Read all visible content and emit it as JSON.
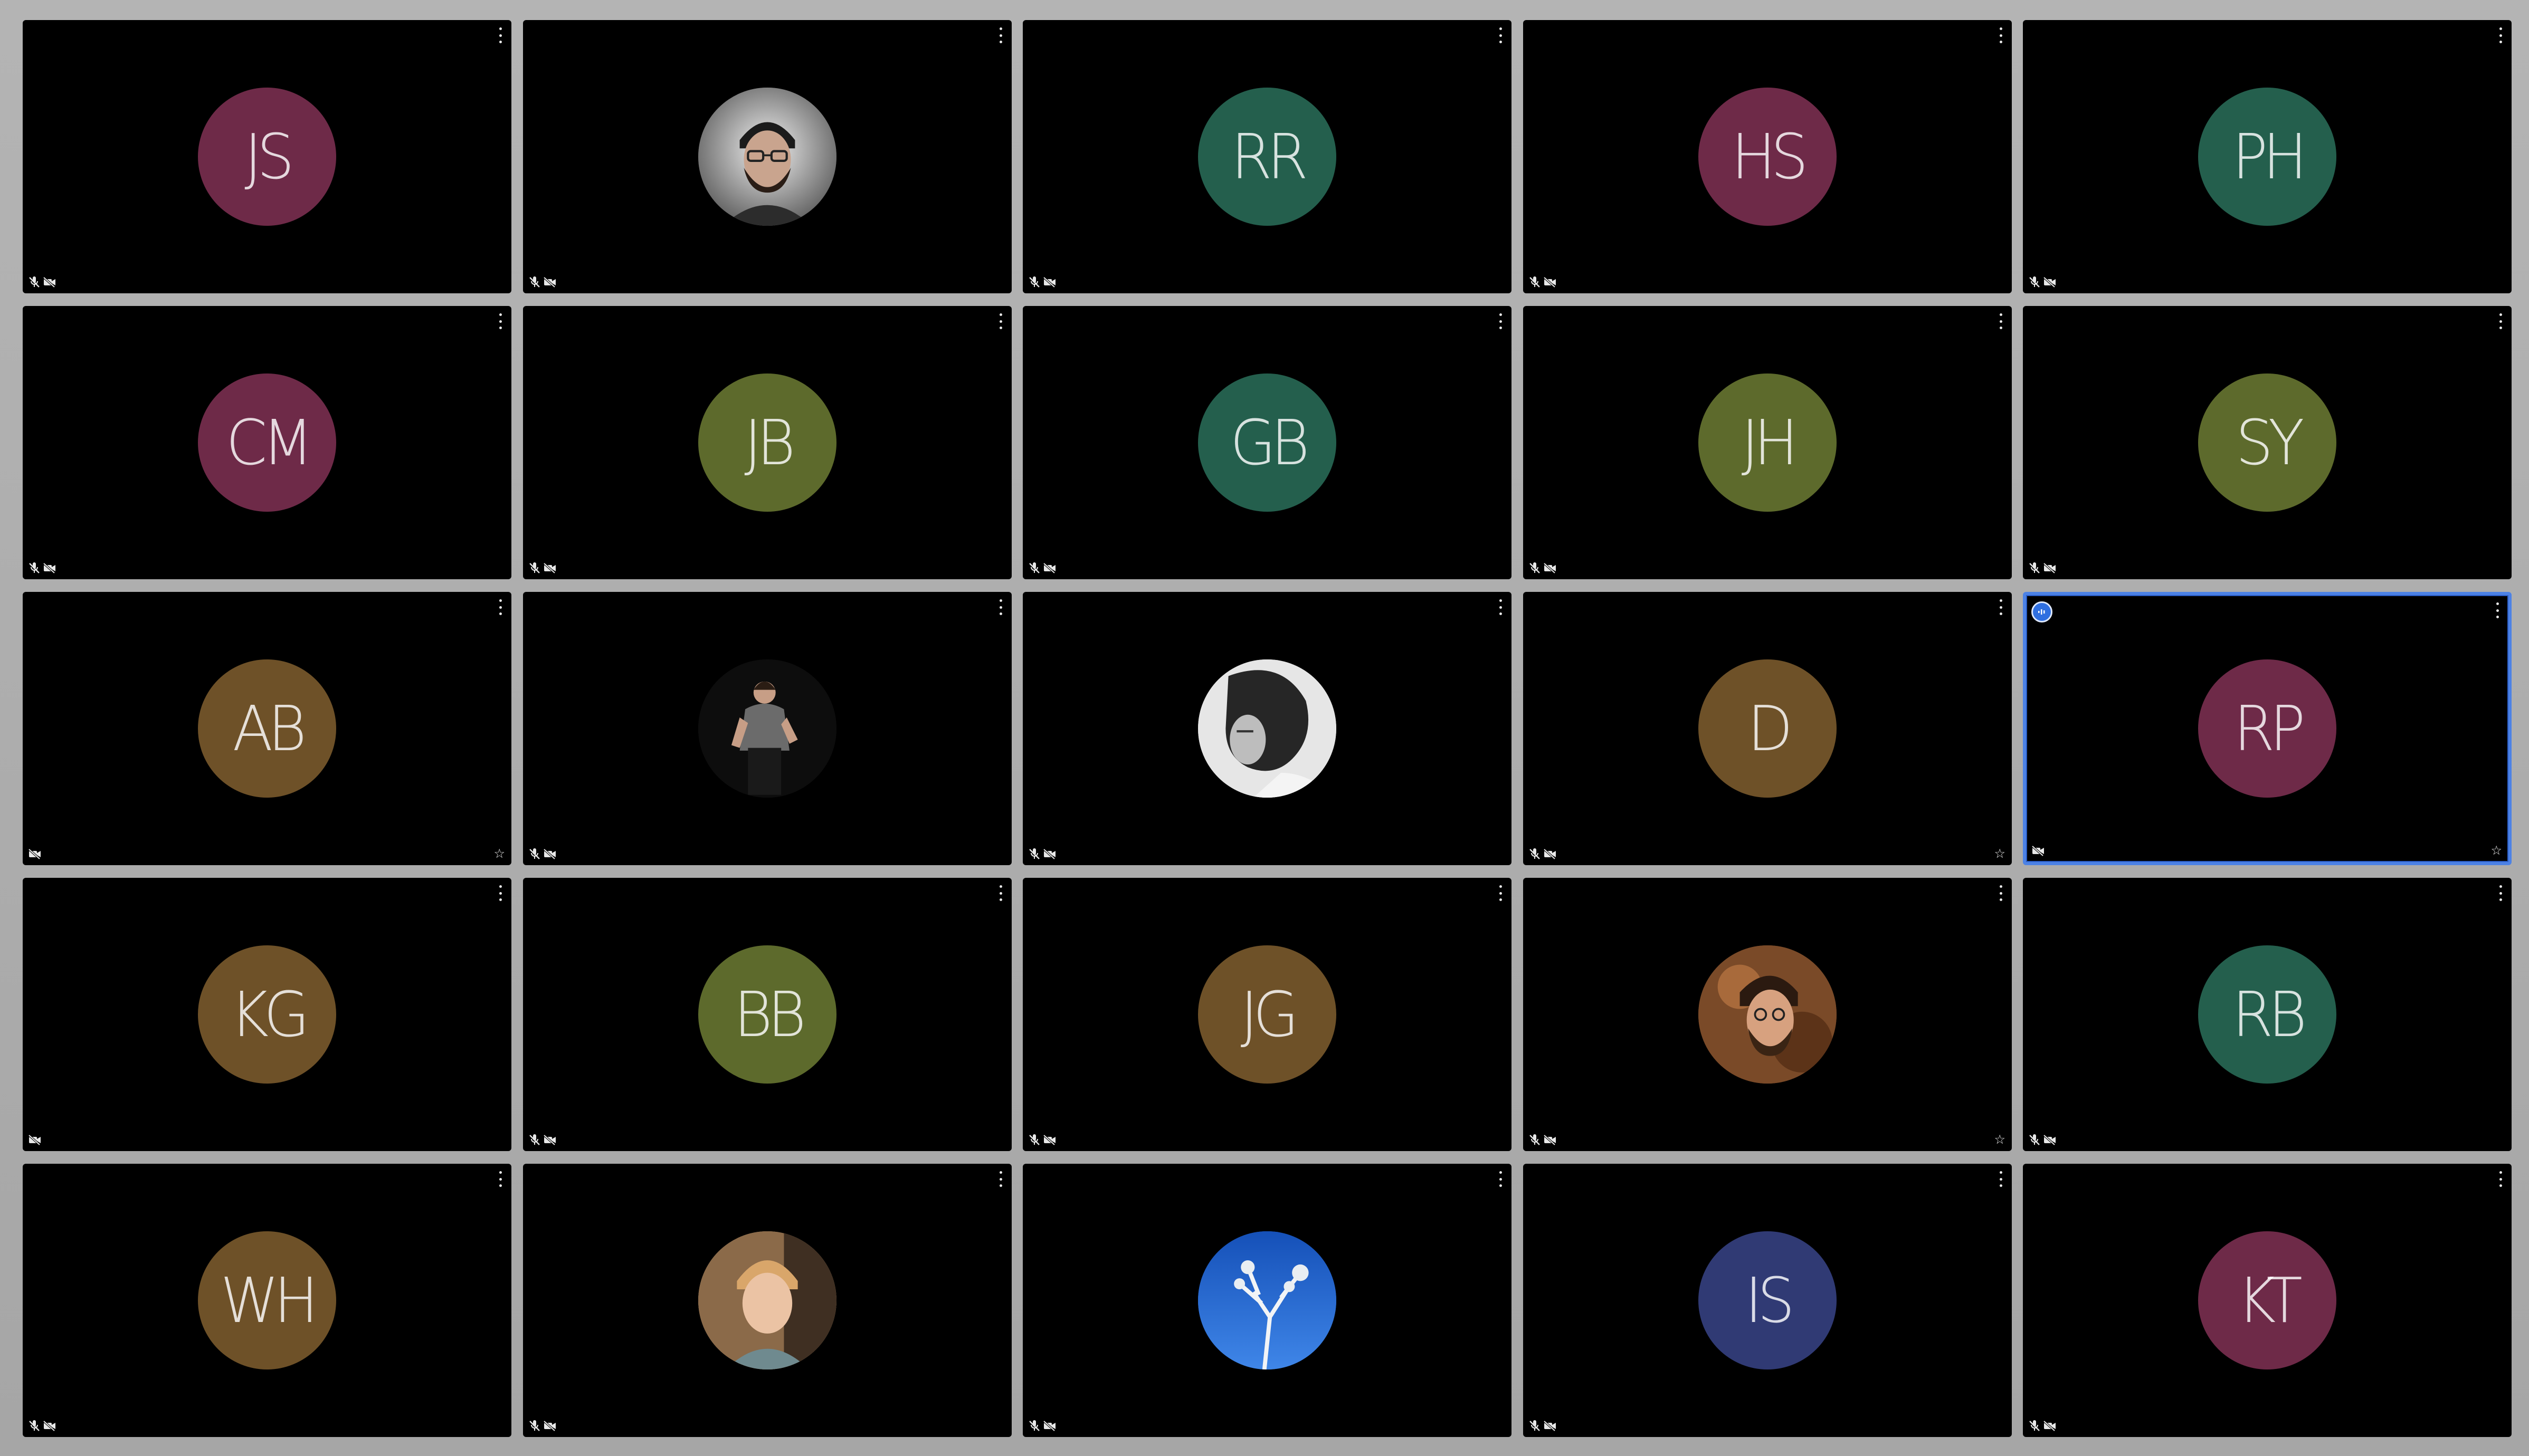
{
  "window": {
    "title": ""
  },
  "colors": {
    "maroon": "#6e2a48",
    "teal": "#245f4d",
    "olive": "#5d6a2c",
    "brown": "#6e5128",
    "indigo": "#303a74",
    "active_border": "#4c82e6",
    "tile_bg": "#000000",
    "gutter": "#ababab"
  },
  "participants": [
    {
      "initials": "JS",
      "avatar": "initials",
      "color": "#6e2a48",
      "mic": "muted",
      "camera": "off",
      "pin": false,
      "active": false
    },
    {
      "initials": "",
      "avatar": "photo-man-glasses",
      "color": "#333333",
      "mic": "muted",
      "camera": "off",
      "pin": false,
      "active": false
    },
    {
      "initials": "RR",
      "avatar": "initials",
      "color": "#245f4d",
      "mic": "muted",
      "camera": "off",
      "pin": false,
      "active": false
    },
    {
      "initials": "HS",
      "avatar": "initials",
      "color": "#6e2a48",
      "mic": "muted",
      "camera": "off",
      "pin": false,
      "active": false
    },
    {
      "initials": "PH",
      "avatar": "initials",
      "color": "#245f4d",
      "mic": "muted",
      "camera": "off",
      "pin": false,
      "active": false
    },
    {
      "initials": "CM",
      "avatar": "initials",
      "color": "#6e2a48",
      "mic": "muted",
      "camera": "off",
      "pin": false,
      "active": false
    },
    {
      "initials": "JB",
      "avatar": "initials",
      "color": "#5d6a2c",
      "mic": "muted",
      "camera": "off",
      "pin": false,
      "active": false
    },
    {
      "initials": "GB",
      "avatar": "initials",
      "color": "#245f4d",
      "mic": "muted",
      "camera": "off",
      "pin": false,
      "active": false
    },
    {
      "initials": "JH",
      "avatar": "initials",
      "color": "#5d6a2c",
      "mic": "muted",
      "camera": "off",
      "pin": false,
      "active": false
    },
    {
      "initials": "SY",
      "avatar": "initials",
      "color": "#5d6a2c",
      "mic": "muted",
      "camera": "off",
      "pin": false,
      "active": false
    },
    {
      "initials": "AB",
      "avatar": "initials",
      "color": "#6e5128",
      "mic": "none",
      "camera": "off",
      "pin": true,
      "active": false
    },
    {
      "initials": "",
      "avatar": "photo-man-standing",
      "color": "#111111",
      "mic": "muted",
      "camera": "off",
      "pin": false,
      "active": false
    },
    {
      "initials": "",
      "avatar": "photo-bw-profile",
      "color": "#cfcfcf",
      "mic": "muted",
      "camera": "off",
      "pin": false,
      "active": false
    },
    {
      "initials": "D",
      "avatar": "initials",
      "color": "#6e5128",
      "mic": "muted",
      "camera": "off",
      "pin": true,
      "active": false
    },
    {
      "initials": "RP",
      "avatar": "initials",
      "color": "#6e2a48",
      "mic": "none",
      "camera": "off",
      "pin": true,
      "active": true
    },
    {
      "initials": "KG",
      "avatar": "initials",
      "color": "#6e5128",
      "mic": "none",
      "camera": "off",
      "pin": false,
      "active": false
    },
    {
      "initials": "BB",
      "avatar": "initials",
      "color": "#5d6a2c",
      "mic": "muted",
      "camera": "off",
      "pin": false,
      "active": false
    },
    {
      "initials": "JG",
      "avatar": "initials",
      "color": "#6e5128",
      "mic": "muted",
      "camera": "off",
      "pin": false,
      "active": false
    },
    {
      "initials": "",
      "avatar": "photo-man-beard",
      "color": "#6b3f22",
      "mic": "muted",
      "camera": "off",
      "pin": true,
      "active": false
    },
    {
      "initials": "RB",
      "avatar": "initials",
      "color": "#245f4d",
      "mic": "muted",
      "camera": "off",
      "pin": false,
      "active": false
    },
    {
      "initials": "WH",
      "avatar": "initials",
      "color": "#6e5128",
      "mic": "muted",
      "camera": "off",
      "pin": false,
      "active": false
    },
    {
      "initials": "",
      "avatar": "photo-man-blonde",
      "color": "#bfa27e",
      "mic": "muted",
      "camera": "off",
      "pin": false,
      "active": false
    },
    {
      "initials": "",
      "avatar": "photo-tree-sky",
      "color": "#1f5bb8",
      "mic": "muted",
      "camera": "off",
      "pin": false,
      "active": false
    },
    {
      "initials": "IS",
      "avatar": "initials",
      "color": "#303a74",
      "mic": "muted",
      "camera": "off",
      "pin": false,
      "active": false
    },
    {
      "initials": "KT",
      "avatar": "initials",
      "color": "#6e2a48",
      "mic": "muted",
      "camera": "off",
      "pin": false,
      "active": false
    }
  ],
  "icons": {
    "menu": "more-vert-icon",
    "mic_muted": "mic-off-icon",
    "camera_off": "videocam-off-icon",
    "pin": "star-outline-icon",
    "speaker": "active-speaker-icon"
  }
}
